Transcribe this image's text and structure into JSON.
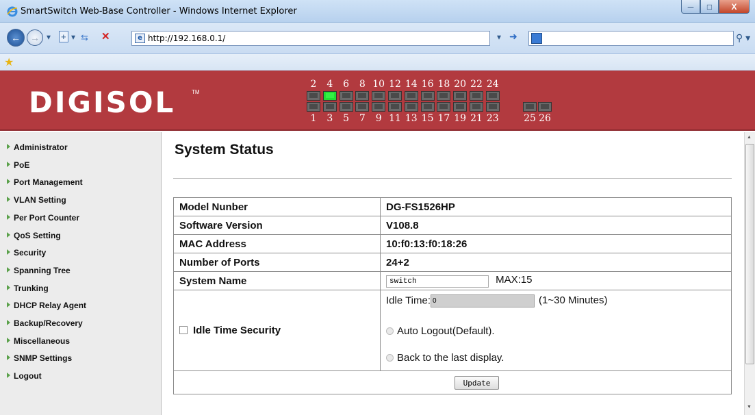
{
  "window": {
    "title": "SmartSwitch Web-Base Controller - Windows Internet Explorer",
    "minimize": "─",
    "maximize": "□",
    "close": "X"
  },
  "browser": {
    "url": "http://192.168.0.1/",
    "search_placeholder": ""
  },
  "banner": {
    "logo": "DIGISOL",
    "logo_tm": "TM",
    "ports_top": [
      "2",
      "4",
      "6",
      "8",
      "10",
      "12",
      "14",
      "16",
      "18",
      "20",
      "22",
      "24"
    ],
    "ports_bottom": [
      "1",
      "3",
      "5",
      "7",
      "9",
      "11",
      "13",
      "15",
      "17",
      "19",
      "21",
      "23"
    ],
    "ports_extra": [
      "25",
      "26"
    ],
    "active_port": "4"
  },
  "sidebar": {
    "items": [
      {
        "label": "Administrator"
      },
      {
        "label": "PoE"
      },
      {
        "label": "Port Management"
      },
      {
        "label": "VLAN Setting"
      },
      {
        "label": "Per Port Counter"
      },
      {
        "label": "QoS Setting"
      },
      {
        "label": "Security"
      },
      {
        "label": "Spanning Tree"
      },
      {
        "label": "Trunking"
      },
      {
        "label": "DHCP Relay Agent"
      },
      {
        "label": "Backup/Recovery"
      },
      {
        "label": "Miscellaneous"
      },
      {
        "label": "SNMP Settings"
      },
      {
        "label": "Logout"
      }
    ]
  },
  "main": {
    "title": "System Status",
    "rows": [
      {
        "label": "Model Nunber",
        "value": "DG-FS1526HP"
      },
      {
        "label": "Software Version",
        "value": "V108.8"
      },
      {
        "label": "MAC Address",
        "value": "10:f0:13:f0:18:26"
      },
      {
        "label": "Number of Ports",
        "value": "24+2"
      }
    ],
    "system_name": {
      "label": "System Name",
      "value": "switch",
      "max": "MAX:15"
    },
    "idle": {
      "label": "Idle Time Security",
      "time_label": "Idle Time:",
      "time_value": "0",
      "time_hint": "(1~30 Minutes)",
      "option_logout": "Auto Logout(Default).",
      "option_back": "Back to the last display."
    },
    "update_button": "Update"
  }
}
